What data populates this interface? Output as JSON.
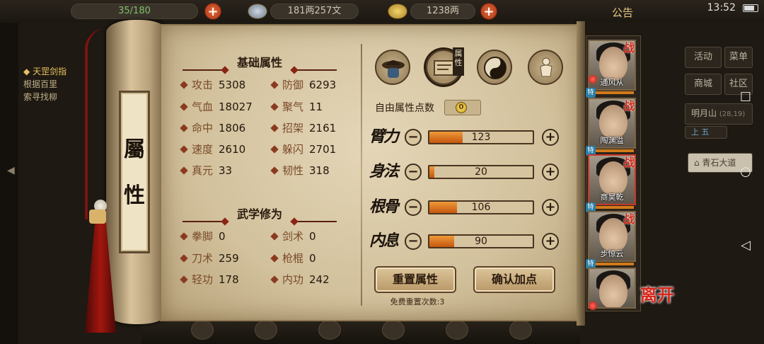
{
  "hud": {
    "capacity": "35/180",
    "silver": "181两257文",
    "gold": "1238两",
    "notice": "公告",
    "clock": "13:52"
  },
  "left_bg": {
    "quest_title": "天罡剑指",
    "quest_line1": "根据百里",
    "quest_line2": "索寻找柳",
    "quest_hint": "◆"
  },
  "right_bg": {
    "menu": [
      "活动",
      "菜单",
      "商城",
      "社区"
    ],
    "location": "明月山",
    "coords": "(28,19)",
    "sub_tabs": [
      "上",
      "五"
    ],
    "road": "青石大道"
  },
  "scroll": {
    "label_chars": [
      "屬",
      "性"
    ]
  },
  "basic": {
    "title": "基础属性",
    "stats": [
      {
        "label": "攻击",
        "value": "5308"
      },
      {
        "label": "防御",
        "value": "6293"
      },
      {
        "label": "气血",
        "value": "18027"
      },
      {
        "label": "聚气",
        "value": "11"
      },
      {
        "label": "命中",
        "value": "1806"
      },
      {
        "label": "招架",
        "value": "2161"
      },
      {
        "label": "速度",
        "value": "2610"
      },
      {
        "label": "躲闪",
        "value": "2701"
      },
      {
        "label": "真元",
        "value": "33"
      },
      {
        "label": "韧性",
        "value": "318"
      }
    ]
  },
  "martial": {
    "title": "武学修为",
    "stats": [
      {
        "label": "拳脚",
        "value": "0"
      },
      {
        "label": "剑术",
        "value": "0"
      },
      {
        "label": "刀术",
        "value": "259"
      },
      {
        "label": "枪棍",
        "value": "0"
      },
      {
        "label": "轻功",
        "value": "178"
      },
      {
        "label": "内功",
        "value": "242"
      }
    ]
  },
  "tabs": {
    "selected_tag": "属性",
    "icons": [
      "hat-icon",
      "scroll-map-icon",
      "bagua-icon",
      "figure-icon"
    ]
  },
  "points": {
    "label": "自由属性点数",
    "value": "0"
  },
  "attributes": [
    {
      "name": "臂力",
      "value": "123",
      "fill": 0.32
    },
    {
      "name": "身法",
      "value": "20",
      "fill": 0.05
    },
    {
      "name": "根骨",
      "value": "106",
      "fill": 0.27
    },
    {
      "name": "内息",
      "value": "90",
      "fill": 0.24
    }
  ],
  "buttons": {
    "reset": "重置属性",
    "confirm": "确认加点",
    "reset_note": "免费重置次数:3"
  },
  "roster": [
    {
      "name": "通风从",
      "tag": "战",
      "level": "特"
    },
    {
      "name": "陶渊溢",
      "tag": "战",
      "level": "特"
    },
    {
      "name": "商昊乾",
      "tag": "战",
      "level": "特"
    },
    {
      "name": "步惊云",
      "tag": "战",
      "level": "特"
    },
    {
      "name": "",
      "tag": "",
      "level": ""
    }
  ],
  "leave": "离开",
  "colors": {
    "accent_orange": "#e07a26",
    "ink": "#2a1a0c",
    "selected_red": "#c8382a"
  }
}
